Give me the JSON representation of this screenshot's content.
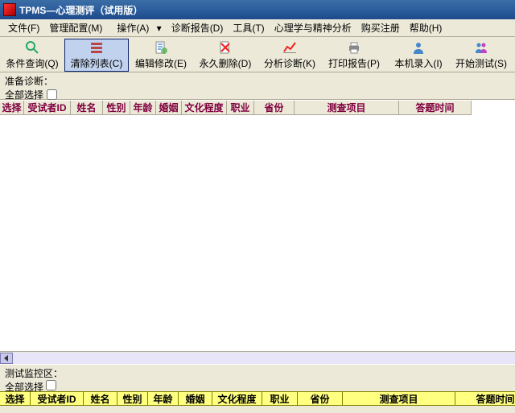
{
  "title": "TPMS—心理测评（试用版）",
  "menu": {
    "file": "文件(F)",
    "config": "管理配置(M)",
    "operate": "操作(A)",
    "diagnose": "诊断报告(D)",
    "tools": "工具(T)",
    "psych": "心理学与精神分析",
    "buy": "购买注册",
    "help": "帮助(H)"
  },
  "toolbar": {
    "query": "条件查询(Q)",
    "clear": "清除列表(C)",
    "edit": "编辑修改(E)",
    "delete": "永久删除(D)",
    "analyze": "分析诊断(K)",
    "print": "打印报告(P)",
    "local": "本机录入(I)",
    "start": "开始测试(S)"
  },
  "prep": {
    "label": "准备诊断：",
    "select_all": "全部选择"
  },
  "columns": {
    "select": "选择",
    "id": "受试者ID",
    "name": "姓名",
    "gender": "性别",
    "age": "年龄",
    "marriage": "婚姻",
    "edu": "文化程度",
    "job": "职业",
    "province": "省份",
    "project": "测查项目",
    "answer_time": "答题时间"
  },
  "monitor": {
    "label": "测试监控区：",
    "select_all": "全部选择"
  },
  "col_widths": {
    "select": 30,
    "id": 58,
    "name": 40,
    "gender": 34,
    "age": 32,
    "marriage": 32,
    "edu": 56,
    "job": 34,
    "province": 50,
    "project": 130,
    "answer_time": 90
  },
  "mcol_widths": {
    "select": 38,
    "id": 66,
    "name": 42,
    "gender": 38,
    "age": 38,
    "marriage": 42,
    "edu": 62,
    "job": 44,
    "province": 56,
    "project": 140,
    "answer_time": 100
  }
}
